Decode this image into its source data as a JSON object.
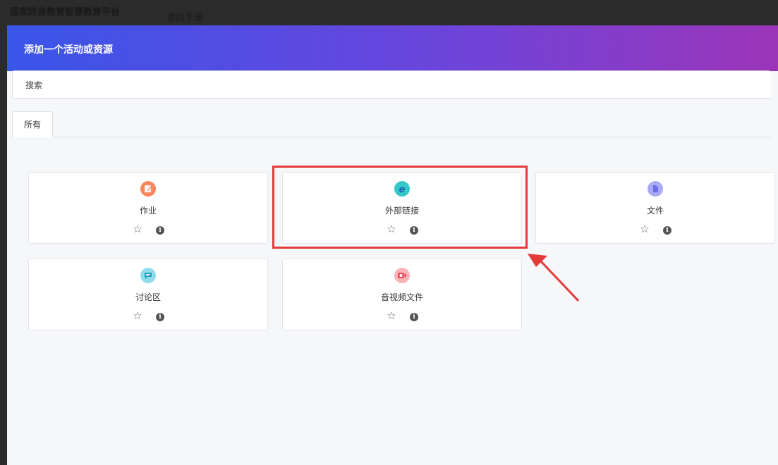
{
  "topbar": {
    "site_title": "国家终身教育智慧教育平台",
    "manual_link": "使用手册"
  },
  "modal": {
    "title": "添加一个活动或资源",
    "search_placeholder": "搜索",
    "tabs": [
      {
        "label": "所有"
      }
    ]
  },
  "cards": [
    {
      "label": "作业",
      "icon": "assignment-icon",
      "color": "#f7875e"
    },
    {
      "label": "外部链接",
      "icon": "ie-link-icon",
      "color": "#33c9c9"
    },
    {
      "label": "文件",
      "icon": "file-icon",
      "color": "#8c8ff0"
    },
    {
      "label": "讨论区",
      "icon": "forum-icon",
      "color": "#32b8d9"
    },
    {
      "label": "音视频文件",
      "icon": "video-icon",
      "color": "#f56d78"
    }
  ],
  "actions": {
    "star_glyph": "☆",
    "info_glyph": "i"
  },
  "colors": {
    "header_gradient_start": "#3a55e9",
    "header_gradient_end": "#9b35b8",
    "highlight": "#e43a3a"
  }
}
